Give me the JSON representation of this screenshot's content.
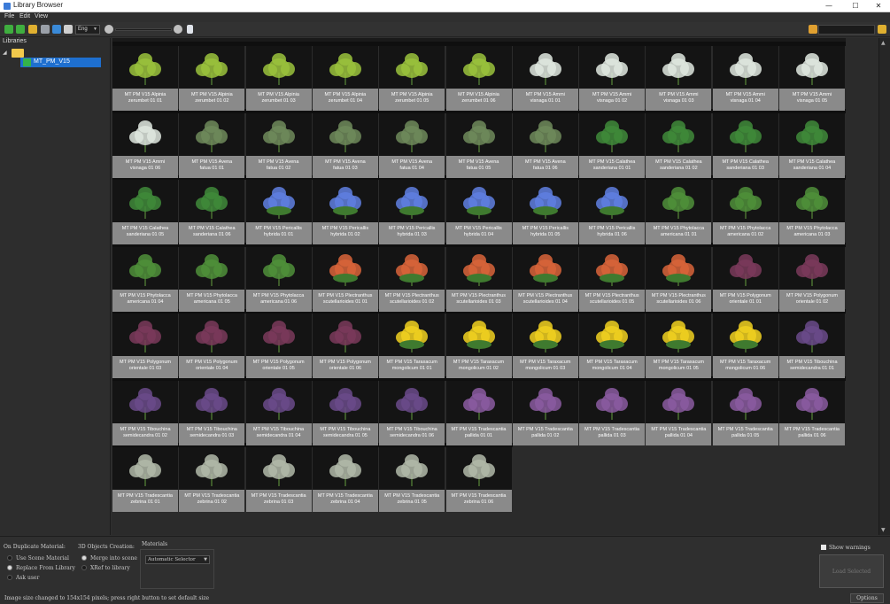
{
  "window": {
    "title": "Library Browser",
    "minimize": "—",
    "maximize": "☐",
    "close": "✕"
  },
  "menu": [
    "File",
    "Edit",
    "View"
  ],
  "toolbar": {
    "language": "Eng"
  },
  "libraries": {
    "header": "Libraries",
    "selected": "MT_PM_V15"
  },
  "assets": [
    "MT PM V15 Alpinia zerumbet 01 01",
    "MT PM V15 Alpinia zerumbet 01 02",
    "MT PM V15 Alpinia zerumbet 01 03",
    "MT PM V15 Alpinia zerumbet 01 04",
    "MT PM V15 Alpinia zerumbet 01 05",
    "MT PM V15 Alpinia zerumbet 01 06",
    "MT PM V15 Ammi visnaga 01 01",
    "MT PM V15 Ammi visnaga 01 02",
    "MT PM V15 Ammi visnaga 01 03",
    "MT PM V15 Ammi visnaga 01 04",
    "MT PM V15 Ammi visnaga 01 05",
    "MT PM V15 Ammi visnaga 01 06",
    "MT PM V15 Avena fatua 01 01",
    "MT PM V15 Avena fatua 01 02",
    "MT PM V15 Avena fatua 01 03",
    "MT PM V15 Avena fatua 01 04",
    "MT PM V15 Avena fatua 01 05",
    "MT PM V15 Avena fatua 01 06",
    "MT PM V15 Calathea sanderiana 01 01",
    "MT PM V15 Calathea sanderiana 01 02",
    "MT PM V15 Calathea sanderiana 01 03",
    "MT PM V15 Calathea sanderiana 01 04",
    "MT PM V15 Calathea sanderiana 01 05",
    "MT PM V15 Calathea sanderiana 01 06",
    "MT PM V15 Pericallis hybrida 01 01",
    "MT PM V15 Pericallis hybrida 01 02",
    "MT PM V15 Pericallis hybrida 01 03",
    "MT PM V15 Pericallis hybrida 01 04",
    "MT PM V15 Pericallis hybrida 01 05",
    "MT PM V15 Pericallis hybrida 01 06",
    "MT PM V15 Phytolacca americana 01 01",
    "MT PM V15 Phytolacca americana 01 02",
    "MT PM V15 Phytolacca americana 01 03",
    "MT PM V15 Phytolacca americana 01 04",
    "MT PM V15 Phytolacca americana 01 05",
    "MT PM V15 Phytolacca americana 01 06",
    "MT PM V15 Plectranthus scutellarioides 01 01",
    "MT PM V15 Plectranthus scutellarioides 01 02",
    "MT PM V15 Plectranthus scutellarioides 01 03",
    "MT PM V15 Plectranthus scutellarioides 01 04",
    "MT PM V15 Plectranthus scutellarioides 01 05",
    "MT PM V15 Plectranthus scutellarioides 01 06",
    "MT PM V15 Polygonum orientale 01 01",
    "MT PM V15 Polygonum orientale 01 02",
    "MT PM V15 Polygonum orientale 01 03",
    "MT PM V15 Polygonum orientale 01 04",
    "MT PM V15 Polygonum orientale 01 05",
    "MT PM V15 Polygonum orientale 01 06",
    "MT PM V15 Taraxacum mongolicum 01 01",
    "MT PM V15 Taraxacum mongolicum 01 02",
    "MT PM V15 Taraxacum mongolicum 01 03",
    "MT PM V15 Taraxacum mongolicum 01 04",
    "MT PM V15 Taraxacum mongolicum 01 05",
    "MT PM V15 Taraxacum mongolicum 01 06",
    "MT PM V15 Tibouchina semidecandra 01 01",
    "MT PM V15 Tibouchina semidecandra 01 02",
    "MT PM V15 Tibouchina semidecandra 01 03",
    "MT PM V15 Tibouchina semidecandra 01 04",
    "MT PM V15 Tibouchina semidecandra 01 05",
    "MT PM V15 Tibouchina semidecandra 01 06",
    "MT PM V15 Tradescantia pallida 01 01",
    "MT PM V15 Tradescantia pallida 01 02",
    "MT PM V15 Tradescantia pallida 01 03",
    "MT PM V15 Tradescantia pallida 01 04",
    "MT PM V15 Tradescantia pallida 01 05",
    "MT PM V15 Tradescantia pallida 01 06",
    "MT PM V15 Tradescantia zebrina 01 01",
    "MT PM V15 Tradescantia zebrina 01 02",
    "MT PM V15 Tradescantia zebrina 01 03",
    "MT PM V15 Tradescantia zebrina 01 04",
    "MT PM V15 Tradescantia zebrina 01 05",
    "MT PM V15 Tradescantia zebrina 01 06"
  ],
  "plant_colors": {
    "Alpinia": "#9ac23c",
    "Ammi": "#dfe7df",
    "Avena": "#6e8a5a",
    "Calathea": "#3f8a3a",
    "Pericallis": "#5f7fe0",
    "Phytolacca": "#4f8f3a",
    "Plectranthus": "#d8643a",
    "Polygonum": "#7a3a5a",
    "Taraxacum": "#f0d020",
    "Tibouchina": "#6a4a8a",
    "Tradescantia pallida": "#8a5aa0",
    "Tradescantia zebrina": "#b0b8a8"
  },
  "bottom": {
    "duplicate_title": "On Duplicate Material:",
    "duplicate_options": [
      "Use Scene Material",
      "Replace From Library",
      "Ask user"
    ],
    "creation_title": "3D Objects Creation:",
    "creation_options": [
      "Merge into scene",
      "XRef to library"
    ],
    "materials_title": "Materials",
    "materials_select": "Automatic Selector",
    "show_warnings": "Show warnings",
    "load_selected": "Load Selected",
    "status": "Image size changed to 154x154 pixels; press right button to set default size",
    "options": "Options"
  }
}
